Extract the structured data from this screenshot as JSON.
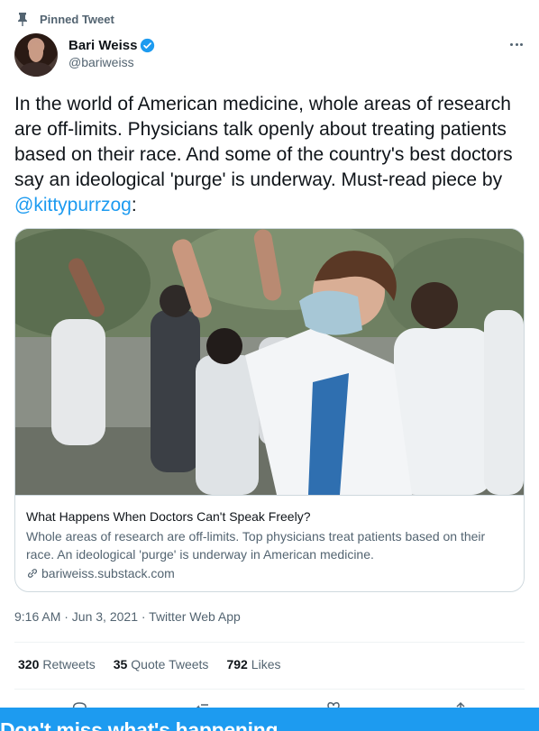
{
  "pinned": {
    "label": "Pinned Tweet",
    "icon": "pin-icon"
  },
  "author": {
    "name": "Bari Weiss",
    "handle": "@bariweiss",
    "verified_icon": "verified-badge-icon"
  },
  "tweet": {
    "text_before": "In the world of American medicine, whole areas of research are off-limits. Physicians talk openly about treating patients based on their race. And some of the country's best doctors say an ideological 'purge' is underway. Must-read piece by ",
    "mention": "@kittypurrzog",
    "text_after": ":"
  },
  "card": {
    "title": "What Happens When Doctors Can't Speak Freely?",
    "description": "Whole areas of research are off-limits. Top physicians treat patients based on their race. An ideological 'purge' is underway in American medicine.",
    "domain": "bariweiss.substack.com"
  },
  "meta": {
    "time": "9:16 AM · Jun 3, 2021 · Twitter Web App"
  },
  "stats": {
    "retweets": {
      "count": "320",
      "label": "Retweets"
    },
    "quotes": {
      "count": "35",
      "label": "Quote Tweets"
    },
    "likes": {
      "count": "792",
      "label": "Likes"
    }
  },
  "banner": {
    "text": "Don't miss what's happening"
  },
  "colors": {
    "accent": "#1d9bf0",
    "secondary_text": "#536471",
    "border": "#cfd9de"
  }
}
